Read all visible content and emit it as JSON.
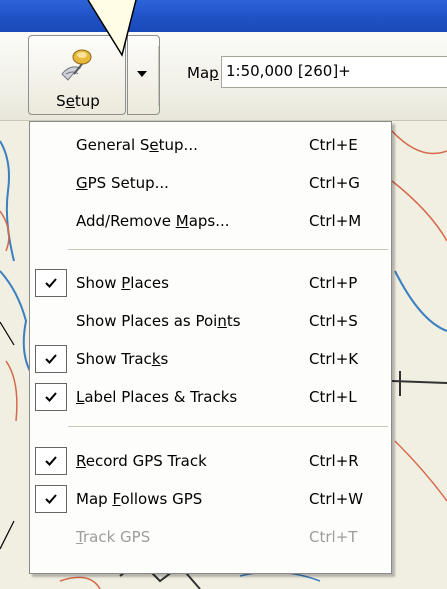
{
  "toolbar": {
    "setup_label_pre": "S",
    "setup_label_u": "e",
    "setup_label_post": "tup",
    "map_label_pre": "Ma",
    "map_label_u": "p",
    "map_value": "1:50,000 [260]+"
  },
  "menu": {
    "items": [
      {
        "pre": "General S",
        "u": "e",
        "post": "tup...",
        "shortcut": "Ctrl+E",
        "checked": false,
        "enabled": true
      },
      {
        "pre": "",
        "u": "G",
        "post": "PS Setup...",
        "shortcut": "Ctrl+G",
        "checked": false,
        "enabled": true
      },
      {
        "pre": "Add/Remove ",
        "u": "M",
        "post": "aps...",
        "shortcut": "Ctrl+M",
        "checked": false,
        "enabled": true
      },
      {
        "pre": "Show ",
        "u": "P",
        "post": "laces",
        "shortcut": "Ctrl+P",
        "checked": true,
        "enabled": true
      },
      {
        "pre": "Show Places as Poi",
        "u": "n",
        "post": "ts",
        "shortcut": "Ctrl+S",
        "checked": false,
        "enabled": true
      },
      {
        "pre": "Show Trac",
        "u": "k",
        "post": "s",
        "shortcut": "Ctrl+K",
        "checked": true,
        "enabled": true
      },
      {
        "pre": "",
        "u": "L",
        "post": "abel Places & Tracks",
        "shortcut": "Ctrl+L",
        "checked": true,
        "enabled": true
      },
      {
        "pre": "",
        "u": "R",
        "post": "ecord GPS Track",
        "shortcut": "Ctrl+R",
        "checked": true,
        "enabled": true
      },
      {
        "pre": "Map ",
        "u": "F",
        "post": "ollows GPS",
        "shortcut": "Ctrl+W",
        "checked": true,
        "enabled": true
      },
      {
        "pre": "",
        "u": "T",
        "post": "rack GPS",
        "shortcut": "Ctrl+T",
        "checked": false,
        "enabled": false
      }
    ]
  },
  "colors": {
    "titlebar": "#1f51c4",
    "menu_bg": "#fdfdfb",
    "disabled_text": "#9d9d9d",
    "map_blue": "#3a7fc0",
    "map_red": "#d46a4a"
  },
  "icons": [
    "setup-satellite-icon",
    "dropdown-arrow-icon",
    "checkmark-icon"
  ]
}
